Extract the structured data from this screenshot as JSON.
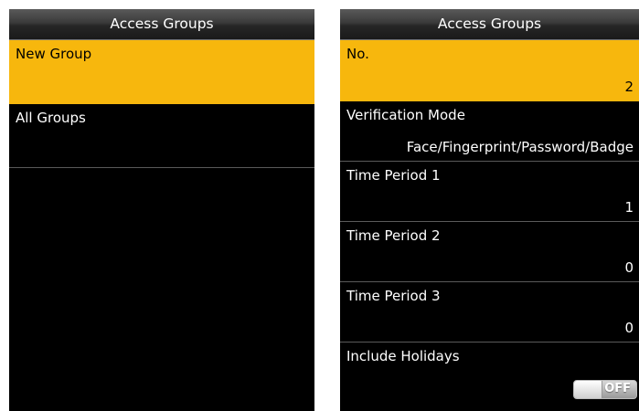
{
  "left_screen": {
    "title": "Access Groups",
    "items": [
      {
        "label": "New Group",
        "selected": true
      },
      {
        "label": "All Groups",
        "selected": false
      }
    ]
  },
  "right_screen": {
    "title": "Access Groups",
    "fields": [
      {
        "label": "No.",
        "value": "2",
        "selected": true
      },
      {
        "label": "Verification Mode",
        "value": "Face/Fingerprint/Password/Badge"
      },
      {
        "label": "Time Period 1",
        "value": "1"
      },
      {
        "label": "Time Period 2",
        "value": "0"
      },
      {
        "label": "Time Period 3",
        "value": "0"
      }
    ],
    "include_holidays": {
      "label": "Include Holidays",
      "toggle_text": "OFF",
      "state": "off"
    }
  },
  "colors": {
    "highlight": "#f7b70d",
    "background": "#000000",
    "title_text": "#ffffff"
  }
}
